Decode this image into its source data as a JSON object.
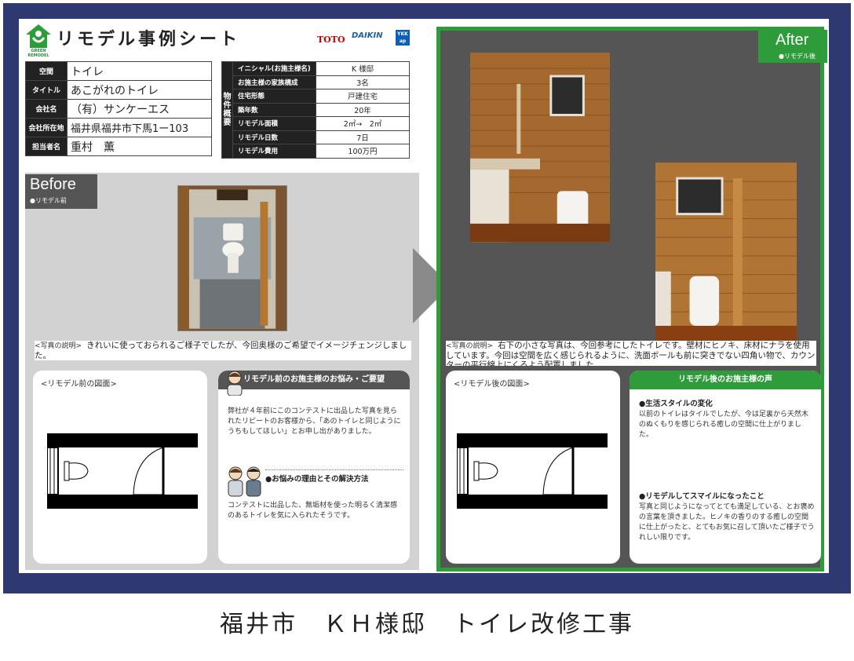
{
  "header": {
    "title": "リモデル事例シート",
    "logo_text": "GREEN REMODEL",
    "brands": [
      "TOTO",
      "DAIKIN",
      "YKK ap"
    ]
  },
  "info": [
    {
      "label": "空間",
      "value": "トイレ"
    },
    {
      "label": "タイトル",
      "value": "あこがれのトイレ"
    },
    {
      "label": "会社名",
      "value": "（有）サンケーエス"
    },
    {
      "label": "会社所在地",
      "value": "福井県福井市下馬1ー103"
    },
    {
      "label": "担当者名",
      "value": "重村　薫"
    }
  ],
  "property": {
    "side_label": "物件概要",
    "rows": [
      {
        "label": "イニシャル(お施主様名)",
        "value": "K 様邸"
      },
      {
        "label": "お施主様の家族構成",
        "value": "3名"
      },
      {
        "label": "住宅形態",
        "value": "戸建住宅"
      },
      {
        "label": "築年数",
        "value": "20年"
      },
      {
        "label": "リモデル面積",
        "value": "2㎡→　2㎡"
      },
      {
        "label": "リモデル日数",
        "value": "7日"
      },
      {
        "label": "リモデル費用",
        "value": "100万円"
      }
    ]
  },
  "before": {
    "badge": "Before",
    "badge_sub": "●リモデル前",
    "photo_label": "<写真の説明>",
    "photo_text": "きれいに使っておられるご様子でしたが、今回奥様のご希望でイメージチェンジしました。",
    "plan_heading": "<リモデル前の図面>",
    "voice_heading": "リモデル前のお施主様のお悩み・ご要望",
    "voice_text": "弊社が４年前にこのコンテストに出品した写真を見られたリピートのお客様から、「あのトイレと同じようにうちもしてほしい」とお申し出がありました。",
    "reason_heading": "●お悩みの理由とその解決方法",
    "reason_text": "コンテストに出品した、無垢材を使った明るく清潔感のあるトイレを気に入られたそうです。"
  },
  "after": {
    "badge": "After",
    "badge_sub": "●リモデル後",
    "photo_label": "<写真の説明>",
    "photo_text": "右下の小さな写真は、今回参考にしたトイレです。壁材にヒノキ、床材にナラを使用しています。今回は空間を広く感じられるように、洗面ボールも前に突きでない四角い物で、カウンターの平行線上にくるよう配置しました。",
    "plan_heading": "<リモデル後の図面>",
    "voice_heading": "リモデル後のお施主様の声",
    "change_heading": "●生活スタイルの変化",
    "change_text": "以前のトイレはタイルでしたが、今は足裏から天然木のぬくもりを感じられる癒しの空間に仕上がりました。",
    "smile_heading": "●リモデルしてスマイルになったこと",
    "smile_text": "写真と同じようになってとても満足している、とお褒めの言葉を頂きました。ヒノキの香りのする癒しの空間に仕上がったと、とてもお気に召して頂いたご様子でうれしい限りです。"
  },
  "footer": "福井市　ＫＨ様邸　トイレ改修工事",
  "colors": {
    "navy": "#2e3871",
    "green": "#2e9c3a",
    "before_gray": "#555555"
  }
}
